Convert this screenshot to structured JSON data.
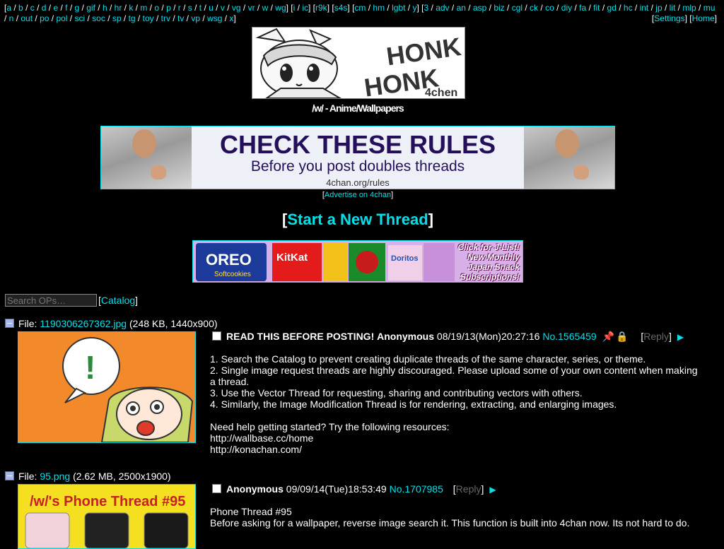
{
  "boardnav": {
    "groups": [
      [
        "a",
        "b",
        "c",
        "d",
        "e",
        "f",
        "g",
        "gif",
        "h",
        "hr",
        "k",
        "m",
        "o",
        "p",
        "r",
        "s",
        "t",
        "u",
        "v",
        "vg",
        "vr",
        "w",
        "wg"
      ],
      [
        "i",
        "ic"
      ],
      [
        "r9k"
      ],
      [
        "s4s"
      ],
      [
        "cm",
        "hm",
        "lgbt",
        "y"
      ],
      [
        "3",
        "adv",
        "an",
        "asp",
        "biz",
        "cgl",
        "ck",
        "co",
        "diy",
        "fa",
        "fit",
        "gd",
        "hc",
        "int",
        "jp",
        "lit",
        "mlp",
        "mu",
        "n",
        "out",
        "po",
        "pol",
        "sci",
        "soc",
        "sp",
        "tg",
        "toy",
        "trv",
        "tv",
        "vp",
        "wsg",
        "x"
      ]
    ],
    "settings_label": "Settings",
    "home_label": "Home"
  },
  "banner": {
    "line1": "HONK",
    "line2": "HONK",
    "mark": "4chen"
  },
  "board_title": "/w/ - Anime/Wallpapers",
  "rules_ad": {
    "heading": "CHECK THESE RULES",
    "subheading": "Before you post doubles threads",
    "url": "4chan.org/rules"
  },
  "advertise_label": "Advertise on 4chan",
  "new_thread_label": "Start a New Thread",
  "snack_ad": {
    "text": "Click for J-List! New Monthly Japan Snack Subscriptions!",
    "products": [
      "OREO",
      "Softcookies",
      "KitKat",
      "Doritos"
    ]
  },
  "search": {
    "placeholder": "Search OPs…"
  },
  "catalog_label": "Catalog",
  "threads": [
    {
      "file_label": "File:",
      "file_name": "1190306267362.jpg",
      "file_meta": "(248 KB, 1440x900)",
      "subject": "READ THIS BEFORE POSTING!",
      "name": "Anonymous",
      "datetime": "08/19/13(Mon)20:27:16",
      "post_no": "No.1565459",
      "reply_label": "Reply",
      "thumb_text": "!",
      "body": [
        "1. Search the Catalog to prevent creating duplicate threads of the same character, series, or theme.",
        "2. Single image request threads are highly discouraged. Please upload some of your own content when making a thread.",
        "3. Use the Vector Thread for requesting, sharing and contributing vectors with others.",
        "4. Similarly, the Image Modification Thread is for rendering, extracting, and enlarging images.",
        "",
        "Need help getting started? Try the following resources:",
        "http://wallbase.cc/home",
        "http://konachan.com/"
      ]
    },
    {
      "file_label": "File:",
      "file_name": "95.png",
      "file_meta": "(2.62 MB, 2500x1900)",
      "subject": "",
      "name": "Anonymous",
      "datetime": "09/09/14(Tue)18:53:49",
      "post_no": "No.1707985",
      "reply_label": "Reply",
      "thumb_text": "/w/'s Phone Thread #95",
      "body": [
        "Phone Thread #95",
        "Before asking for a wallpaper, reverse image search it. This function is built into 4chan now. Its not hard to do."
      ]
    }
  ],
  "colors": {
    "background": "#000000",
    "link": "#00e0e8",
    "text": "#ffffff",
    "reply": "#666666"
  }
}
